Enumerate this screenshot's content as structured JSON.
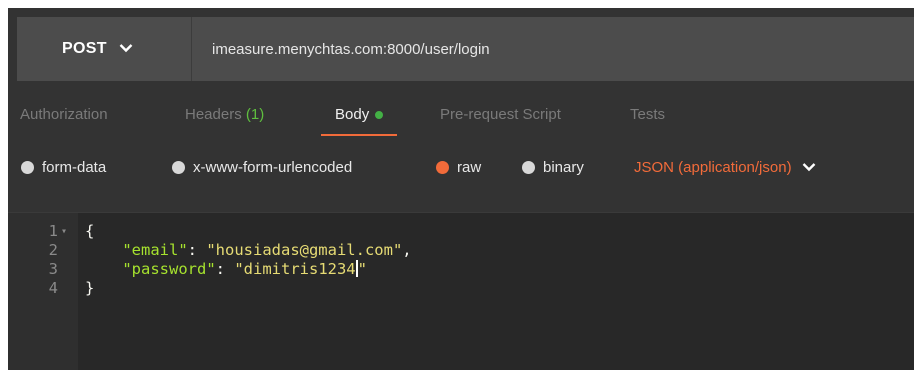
{
  "request": {
    "method": "POST",
    "url": "imeasure.menychtas.com:8000/user/login"
  },
  "tabs": [
    {
      "label": "Authorization"
    },
    {
      "label": "Headers",
      "count": "(1)"
    },
    {
      "label": "Body"
    },
    {
      "label": "Pre-request Script"
    },
    {
      "label": "Tests"
    }
  ],
  "body_options": {
    "form_data": "form-data",
    "urlencoded": "x-www-form-urlencoded",
    "raw": "raw",
    "binary": "binary",
    "content_type": "JSON (application/json)",
    "selected": "raw"
  },
  "editor": {
    "line_numbers": [
      "1",
      "2",
      "3",
      "4"
    ],
    "open_brace": "{",
    "close_brace": "}",
    "email_key": "\"email\"",
    "email_value": "\"housiadas@gmail.com\"",
    "password_key": "\"password\"",
    "password_value": "\"dimitris1234",
    "password_value_end": "\""
  },
  "icons": {
    "method_dropdown": "chevron-down-icon",
    "content_type_dropdown": "chevron-down-icon",
    "fold": "fold-arrow-icon"
  },
  "colors": {
    "accent": "#f26b3a",
    "active_dot": "#43b045",
    "header_count": "#5fbf3f"
  }
}
